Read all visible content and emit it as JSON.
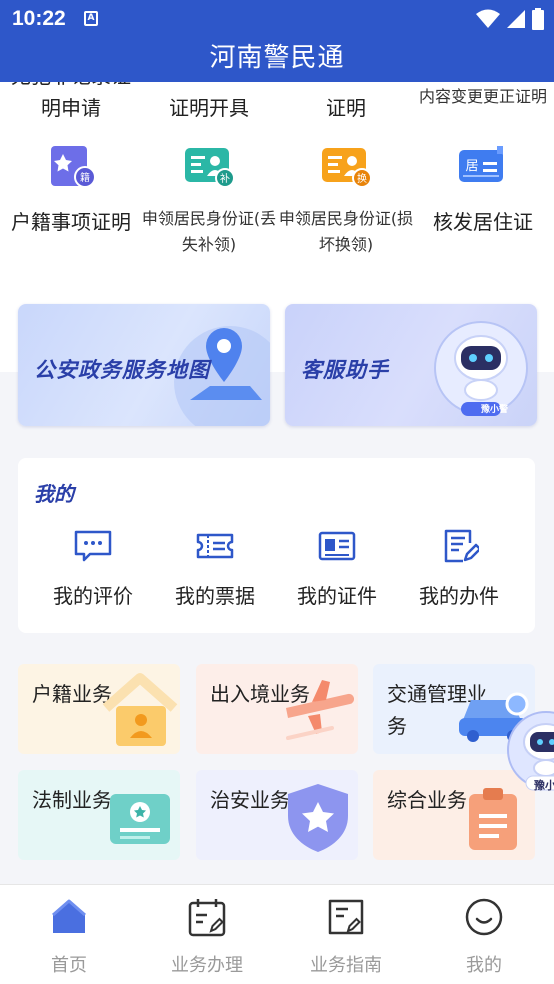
{
  "status_bar": {
    "time": "10:22"
  },
  "app": {
    "title": "河南警民通"
  },
  "top_grid": {
    "row_partial": [
      {
        "label": "无犯罪记录证明申请"
      },
      {
        "label": "证明开具"
      },
      {
        "label": "证明"
      },
      {
        "label": "内容变更更正证明"
      }
    ],
    "row2": [
      {
        "label": "户籍事项证明",
        "icon": "household-id-icon"
      },
      {
        "label": "申领居民身份证(丢失补领)",
        "icon": "id-card-reissue-icon"
      },
      {
        "label": "申领居民身份证(损坏换领)",
        "icon": "id-card-replace-icon"
      },
      {
        "label": "核发居住证",
        "icon": "residence-permit-icon"
      }
    ]
  },
  "banners": {
    "map": "公安政务服务地图",
    "assistant": "客服助手",
    "robot_tag": "豫小警"
  },
  "mine": {
    "title": "我的",
    "items": [
      {
        "label": "我的评价",
        "icon": "comment-icon"
      },
      {
        "label": "我的票据",
        "icon": "ticket-icon"
      },
      {
        "label": "我的证件",
        "icon": "id-card-icon"
      },
      {
        "label": "我的办件",
        "icon": "edit-document-icon"
      }
    ]
  },
  "business": [
    {
      "label": "户籍业务",
      "icon": "house-icon"
    },
    {
      "label": "出入境业务",
      "icon": "airplane-icon"
    },
    {
      "label": "交通管理业务",
      "icon": "car-icon"
    },
    {
      "label": "法制业务",
      "icon": "certificate-icon"
    },
    {
      "label": "治安业务",
      "icon": "police-badge-icon"
    },
    {
      "label": "综合业务",
      "icon": "clipboard-icon"
    }
  ],
  "float_assistant": {
    "tag": "豫小警"
  },
  "tabbar": [
    {
      "label": "首页",
      "icon": "home-icon",
      "active": true
    },
    {
      "label": "业务办理",
      "icon": "calendar-task-icon",
      "active": false
    },
    {
      "label": "业务指南",
      "icon": "guide-doc-icon",
      "active": false
    },
    {
      "label": "我的",
      "icon": "smile-icon",
      "active": false
    }
  ],
  "colors": {
    "primary": "#2e57c9",
    "banner_text": "#2a3fa8",
    "tab_inactive": "#9a9a9a"
  }
}
